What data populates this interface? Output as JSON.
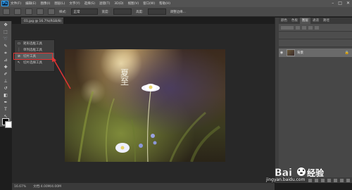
{
  "app": {
    "logo": "Ps"
  },
  "menubar": {
    "items": [
      "文件(F)",
      "编辑(E)",
      "图像(I)",
      "图层(L)",
      "文字(Y)",
      "选择(S)",
      "滤镜(T)",
      "3D(D)",
      "视图(V)",
      "窗口(W)",
      "帮助(H)"
    ],
    "window_controls": [
      "–",
      "□",
      "✕"
    ]
  },
  "optionsbar": {
    "style_label": "样式:",
    "style_value": "正常",
    "width_label": "宽度:",
    "height_label": "高度:",
    "extra_label": "调整边缘..."
  },
  "document": {
    "tab_label": "01.jpg @ 16.7%(RGB/8)"
  },
  "flyout": {
    "items": [
      {
        "label": "矩形选框工具",
        "icon": "▭"
      },
      {
        "label": "单列选框工具",
        "icon": "⋮"
      },
      {
        "label": "切片工具",
        "icon": "⧄"
      },
      {
        "label": "切片选择工具",
        "icon": "↖"
      }
    ]
  },
  "canvas": {
    "overlay_text": "夏 至"
  },
  "right_panel": {
    "tabs": [
      "颜色",
      "色板",
      "图层",
      "通道",
      "路径"
    ],
    "active_tab": "图层",
    "layer": {
      "name": "背景",
      "lock": "🔒"
    }
  },
  "statusbar": {
    "zoom": "16.67%",
    "doc": "文档:4.00M/4.00M"
  },
  "watermark": {
    "brand": "Baidu经验",
    "url": "jingyan.baidu.com"
  },
  "colors": {
    "annotation": "#e23434",
    "accent": "#31a8ff"
  }
}
